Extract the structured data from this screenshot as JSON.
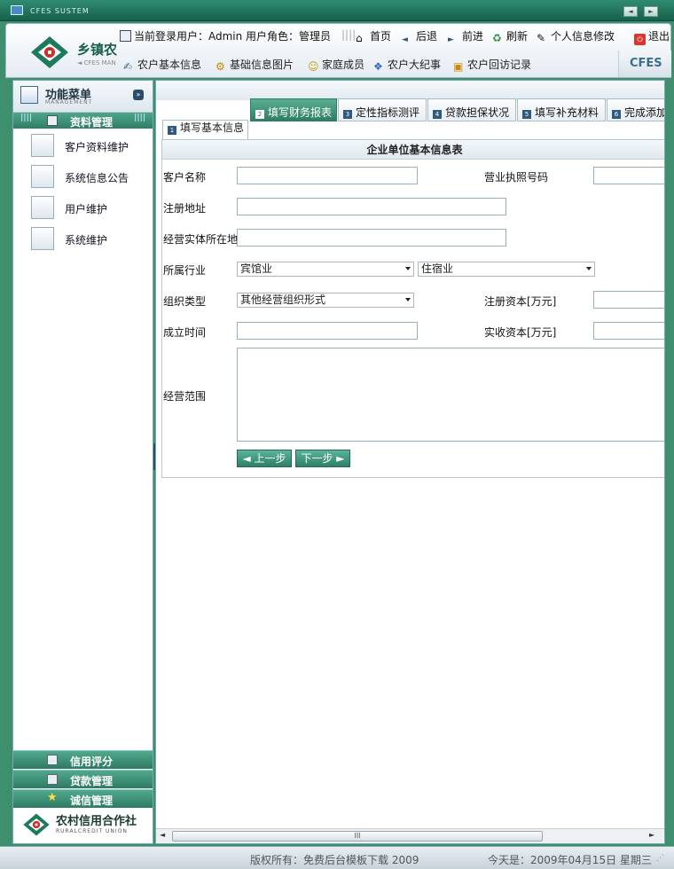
{
  "window": {
    "system_title": "CFES SUSTEM",
    "btn_prev": "◄",
    "btn_next": "►"
  },
  "header": {
    "logo_cn": "乡镇农",
    "logo_en": "◄ CFES MAN",
    "badge": "CFES",
    "user_info": "当前登录用户：Admin 用户角色：管理员",
    "links": {
      "home": "首页",
      "back": "后退",
      "forward": "前进",
      "refresh": "刷新",
      "profile": "个人信息修改",
      "logout": "退出"
    },
    "nav": [
      "农户基本信息",
      "基础信息图片",
      "家庭成员",
      "农户大纪事",
      "农户回访记录"
    ]
  },
  "sidebar": {
    "menu_title": "功能菜单",
    "menu_sub": "MANAGEMENT",
    "section": "资料管理",
    "items": [
      "客户资料维护",
      "系统信息公告",
      "用户维护",
      "系统维护"
    ],
    "bottom_sections": [
      "信用评分",
      "贷款管理",
      "诚信管理"
    ],
    "org_cn": "农村信用合作社",
    "org_en": "RURALCREDIT UNION"
  },
  "tabs": [
    {
      "num": "2",
      "label": "填写财务报表"
    },
    {
      "num": "3",
      "label": "定性指标测评"
    },
    {
      "num": "4",
      "label": "贷款担保状况"
    },
    {
      "num": "5",
      "label": "填写补充材料"
    },
    {
      "num": "6",
      "label": "完成添加"
    }
  ],
  "base_tab": {
    "num": "1",
    "label": "填写基本信息"
  },
  "form": {
    "title": "企业单位基本信息表",
    "labels": {
      "customer_name": "客户名称",
      "license_no": "营业执照号码",
      "reg_address": "注册地址",
      "entity_location": "经营实体所在地",
      "industry": "所属行业",
      "org_type": "组织类型",
      "reg_capital": "注册资本[万元]",
      "found_date": "成立时间",
      "paid_capital": "实收资本[万元]",
      "scope": "经营范围"
    },
    "industry_value": "宾馆业",
    "industry_sub_value": "住宿业",
    "org_type_value": "其他经营组织形式",
    "prev_button": "◄ 上一步",
    "next_button": "下一步 ►"
  },
  "scrollbar": {
    "thumb": "III",
    "left": "◄",
    "right": "►"
  },
  "footer": {
    "copyright": "版权所有：免费后台模板下载 2009",
    "today": "今天是：2009年04月15日 星期三"
  }
}
